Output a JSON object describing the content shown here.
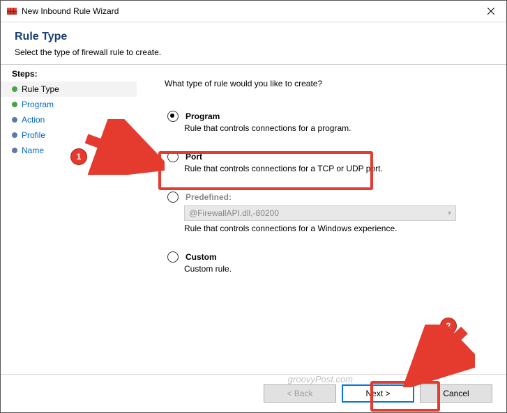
{
  "window": {
    "title": "New Inbound Rule Wizard"
  },
  "header": {
    "title": "Rule Type",
    "subtitle": "Select the type of firewall rule to create."
  },
  "sidebar": {
    "label": "Steps:",
    "items": [
      {
        "label": "Rule Type",
        "state": "selected"
      },
      {
        "label": "Program",
        "state": "current-link"
      },
      {
        "label": "Action",
        "state": "pending"
      },
      {
        "label": "Profile",
        "state": "pending"
      },
      {
        "label": "Name",
        "state": "pending"
      }
    ]
  },
  "main": {
    "question": "What type of rule would you like to create?",
    "options": [
      {
        "key": "program",
        "label": "Program",
        "desc": "Rule that controls connections for a program.",
        "checked": true
      },
      {
        "key": "port",
        "label": "Port",
        "desc": "Rule that controls connections for a TCP or UDP port.",
        "checked": false
      },
      {
        "key": "predefined",
        "label": "Predefined:",
        "desc": "Rule that controls connections for a Windows experience.",
        "checked": false,
        "disabled": true,
        "combo_value": "@FirewallAPI.dll,-80200"
      },
      {
        "key": "custom",
        "label": "Custom",
        "desc": "Custom rule.",
        "checked": false
      }
    ]
  },
  "footer": {
    "back": "< Back",
    "next": "Next >",
    "cancel": "Cancel"
  },
  "watermark": "groovyPost.com",
  "annotations": {
    "badge1": "1",
    "badge2": "2",
    "highlight_port": true,
    "highlight_next": true
  },
  "colors": {
    "accent_red": "#e53b2e",
    "link": "#0066cc",
    "heading": "#1a3e6e"
  }
}
